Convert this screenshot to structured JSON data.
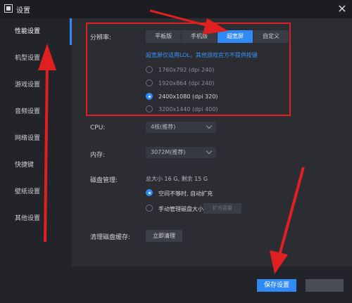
{
  "window": {
    "title": "设置"
  },
  "sidebar": {
    "items": [
      {
        "label": "性能设置",
        "active": true
      },
      {
        "label": "机型设置"
      },
      {
        "label": "游戏设置"
      },
      {
        "label": "音频设置"
      },
      {
        "label": "网络设置"
      },
      {
        "label": "快捷键"
      },
      {
        "label": "壁纸设置"
      },
      {
        "label": "其他设置"
      }
    ]
  },
  "resolution": {
    "label": "分辨率:",
    "tabs": [
      "平板版",
      "手机版",
      "超宽屏",
      "自定义"
    ],
    "active_tab": "超宽屏",
    "hint": "超宽屏仅适用LOL，其他游戏官方不提供按键",
    "options": [
      {
        "label": "1760x792  (dpi 240)",
        "checked": false
      },
      {
        "label": "1920x864  (dpi 240)",
        "checked": false
      },
      {
        "label": "2400x1080  (dpi 320)",
        "checked": true
      },
      {
        "label": "3200x1440  (dpi 400)",
        "checked": false
      }
    ]
  },
  "cpu": {
    "label": "CPU:",
    "value": "4核(推荐)"
  },
  "memory": {
    "label": "内存:",
    "value": "3072M(推荐)"
  },
  "disk": {
    "label": "磁盘管理:",
    "info": "总大小 16 G,  剩余 15 G",
    "auto_label": "空间不够时, 自动扩充",
    "manual_label": "手动管理磁盘大小",
    "expand_label": "扩充容量"
  },
  "cache": {
    "label": "清理磁盘缓存:",
    "button": "立即清理"
  },
  "footer": {
    "save_label": "保存设置",
    "cancel_label": ""
  },
  "colors": {
    "accent": "#2f8af5",
    "annotation": "#e02020",
    "background": "#2b2d33"
  },
  "icons": {
    "app": "settings-window-icon",
    "close": "close-icon"
  }
}
